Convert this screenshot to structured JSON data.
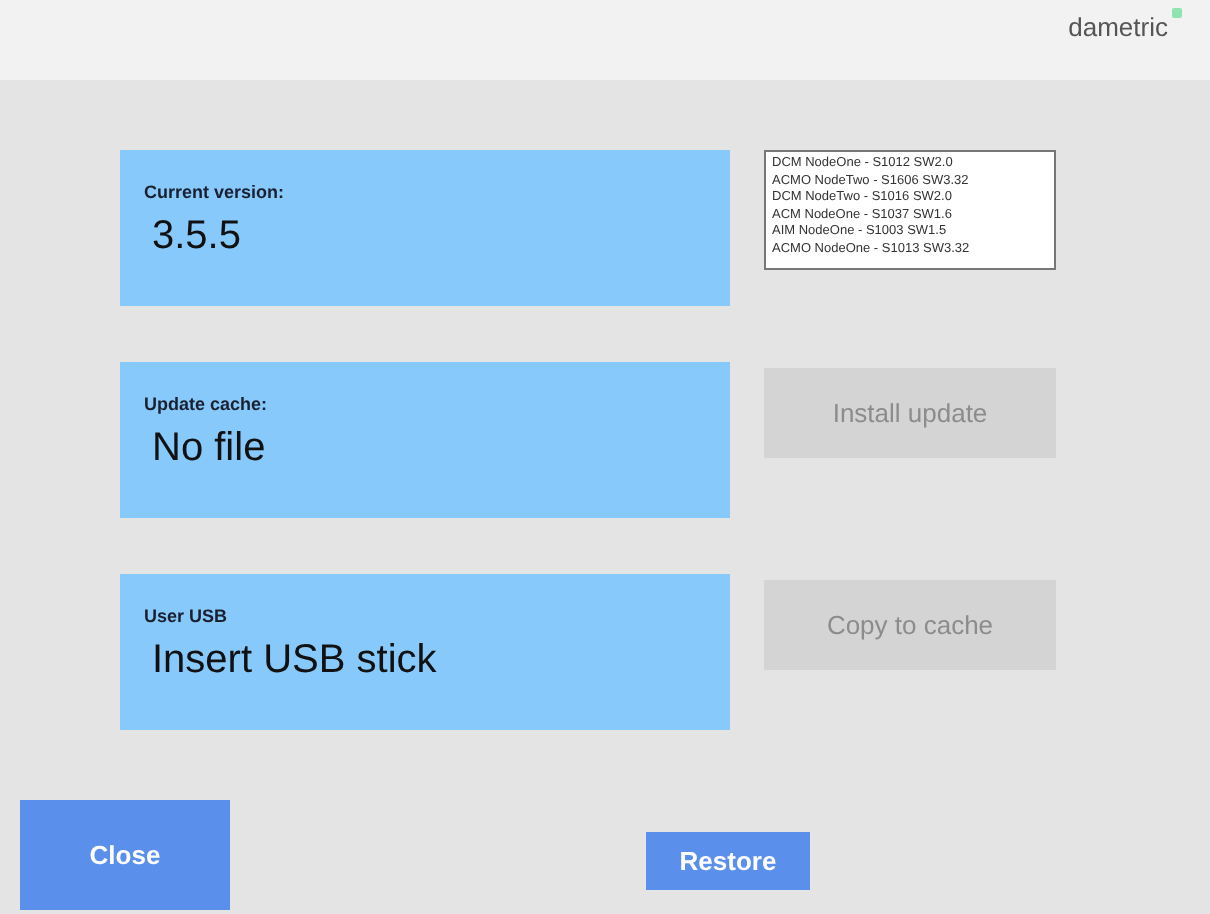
{
  "brand": "dametric",
  "rows": [
    {
      "label": "Current version:",
      "value": "3.5.5",
      "side": {
        "kind": "list",
        "items": [
          "DCM NodeOne - S1012 SW2.0",
          "ACMO NodeTwo - S1606 SW3.32",
          "DCM NodeTwo - S1016 SW2.0",
          "ACM NodeOne - S1037 SW1.6",
          "AIM NodeOne - S1003 SW1.5",
          "ACMO NodeOne - S1013 SW3.32"
        ]
      }
    },
    {
      "label": "Update cache:",
      "value": "No file",
      "side": {
        "kind": "button",
        "text": "Install update",
        "disabled": true
      }
    },
    {
      "label": "User USB",
      "value": "Insert USB stick",
      "side": {
        "kind": "button",
        "text": "Copy to cache",
        "disabled": true
      }
    }
  ],
  "footer": [
    {
      "text": "Close",
      "disabled": false
    },
    {
      "text": "Restore",
      "disabled": false
    }
  ]
}
